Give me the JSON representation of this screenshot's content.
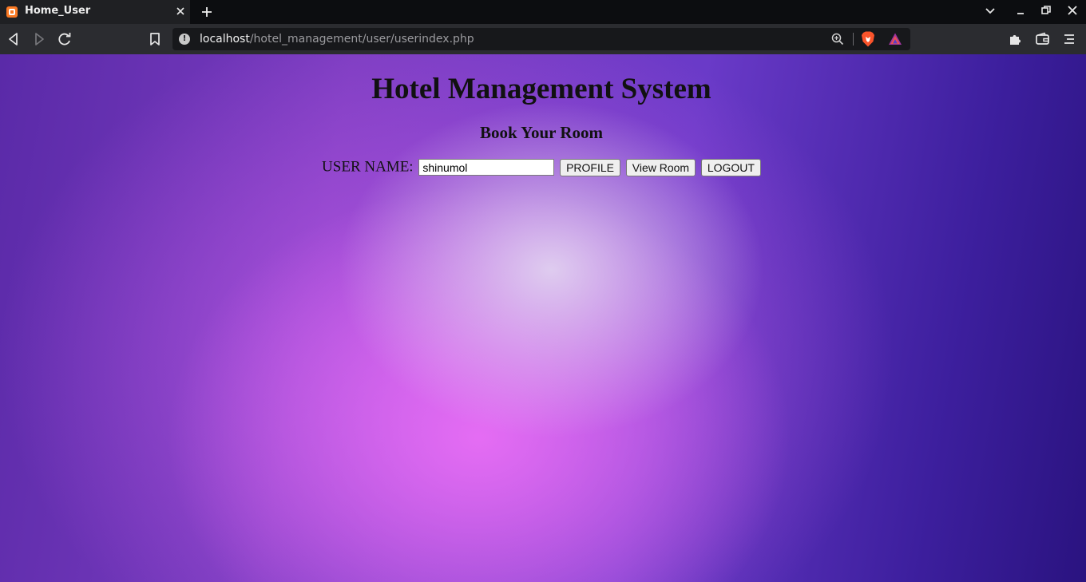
{
  "browser": {
    "tab_title": "Home_User",
    "url_host": "localhost",
    "url_path": "/hotel_management/user/userindex.php",
    "colors": {
      "titlebar": "#0c0d10",
      "tab": "#1f2023",
      "toolbar": "#2b2c30",
      "urlbar": "#17181b",
      "brave_orange": "#fb542b"
    }
  },
  "page": {
    "title": "Hotel Management System",
    "subtitle": "Book Your Room",
    "user_label": "USER NAME:",
    "username_value": "shinumol",
    "buttons": {
      "profile": "PROFILE",
      "view_room": "View Room",
      "logout": "LOGOUT"
    }
  }
}
